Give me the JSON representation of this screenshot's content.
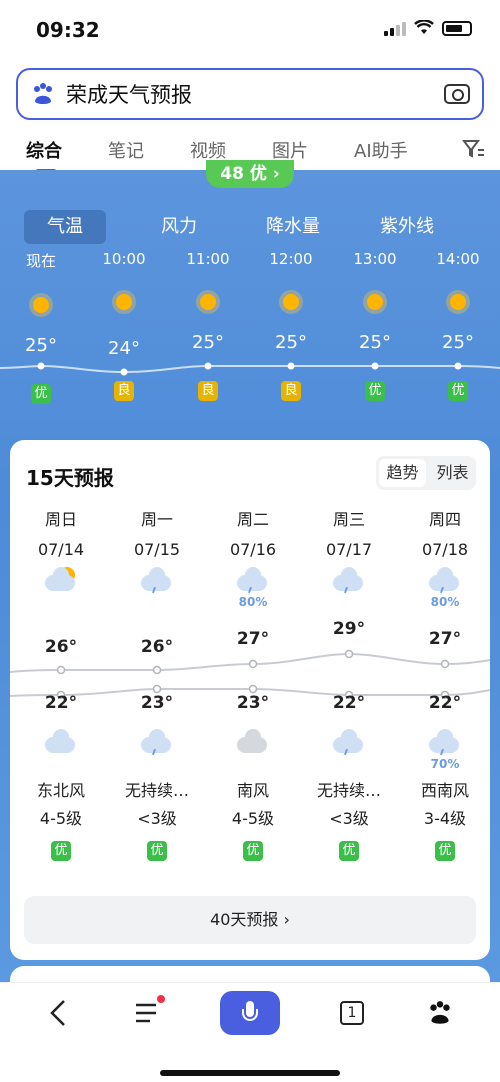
{
  "status": {
    "time": "09:32"
  },
  "search": {
    "query": "荣成天气预报"
  },
  "tabs": [
    "综合",
    "笔记",
    "视频",
    "图片",
    "AI助手"
  ],
  "aqi": {
    "label": "48 优 ›"
  },
  "subtabs": [
    "气温",
    "风力",
    "降水量",
    "紫外线"
  ],
  "hourly": [
    {
      "time": "现在",
      "temp": "25°",
      "quality": "优",
      "q": "good"
    },
    {
      "time": "10:00",
      "temp": "24°",
      "quality": "良",
      "q": "ok"
    },
    {
      "time": "11:00",
      "temp": "25°",
      "quality": "良",
      "q": "ok"
    },
    {
      "time": "12:00",
      "temp": "25°",
      "quality": "良",
      "q": "ok"
    },
    {
      "time": "13:00",
      "temp": "25°",
      "quality": "优",
      "q": "good"
    },
    {
      "time": "14:00",
      "temp": "25°",
      "quality": "优",
      "q": "good"
    }
  ],
  "forecast": {
    "title": "15天预报",
    "toggle": [
      "趋势",
      "列表"
    ],
    "days": [
      {
        "name": "周日",
        "date": "07/14",
        "icon": "sun-cloud-icon",
        "pct": "",
        "hi": "26°",
        "lo": "22°",
        "night_icon": "moon-cloud-icon",
        "night_pct": "",
        "wind": "东北风",
        "level": "4-5级",
        "quality": "优"
      },
      {
        "name": "周一",
        "date": "07/15",
        "icon": "rain-cloud-icon",
        "pct": "",
        "hi": "26°",
        "lo": "23°",
        "night_icon": "rain-cloud-icon",
        "night_pct": "",
        "wind": "无持续…",
        "level": "<3级",
        "quality": "优"
      },
      {
        "name": "周二",
        "date": "07/16",
        "icon": "rain-cloud-icon",
        "pct": "80%",
        "hi": "27°",
        "lo": "23°",
        "night_icon": "cloud-icon",
        "night_pct": "",
        "wind": "南风",
        "level": "4-5级",
        "quality": "优"
      },
      {
        "name": "周三",
        "date": "07/17",
        "icon": "rain-cloud-icon",
        "pct": "",
        "hi": "29°",
        "lo": "22°",
        "night_icon": "rain-cloud-icon",
        "night_pct": "",
        "wind": "无持续…",
        "level": "<3级",
        "quality": "优"
      },
      {
        "name": "周四",
        "date": "07/18",
        "icon": "rain-cloud-icon",
        "pct": "80%",
        "hi": "27°",
        "lo": "22°",
        "night_icon": "rain-cloud-icon",
        "night_pct": "70%",
        "wind": "西南风",
        "level": "3-4级",
        "quality": "优"
      }
    ],
    "more": "40天预报 ›"
  }
}
